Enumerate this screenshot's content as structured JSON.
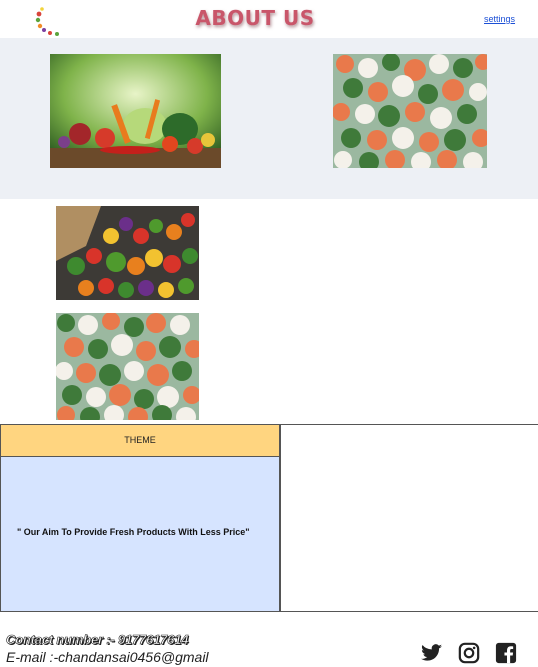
{
  "header": {
    "title": "ABOUT US",
    "settings_label": "settings",
    "logo_icon": "crescent-logo-icon"
  },
  "gallery": {
    "images": [
      {
        "name": "fresh-vegetables-photo",
        "alt": ""
      },
      {
        "name": "frozen-mixed-vegetables-photo",
        "alt": ""
      },
      {
        "name": "vegetable-assortment-photo",
        "alt": ""
      },
      {
        "name": "frozen-vegetables-photo-2",
        "alt": ""
      }
    ]
  },
  "theme": {
    "heading": "THEME",
    "statement": "\" Our Aim To Provide Fresh Products With Less Price\""
  },
  "footer": {
    "contact": "Contact number :- 9177617614",
    "email": "E-mail :-chandansai0456@gmail",
    "social_icons": [
      "twitter-icon",
      "instagram-icon",
      "facebook-icon"
    ]
  },
  "colors": {
    "title": "#c9566a",
    "gallery_bg": "#edf0f5",
    "theme_head_bg": "#ffd580",
    "theme_body_bg": "#d6e4ff",
    "link": "#1b4fd6",
    "icon": "#222222"
  }
}
